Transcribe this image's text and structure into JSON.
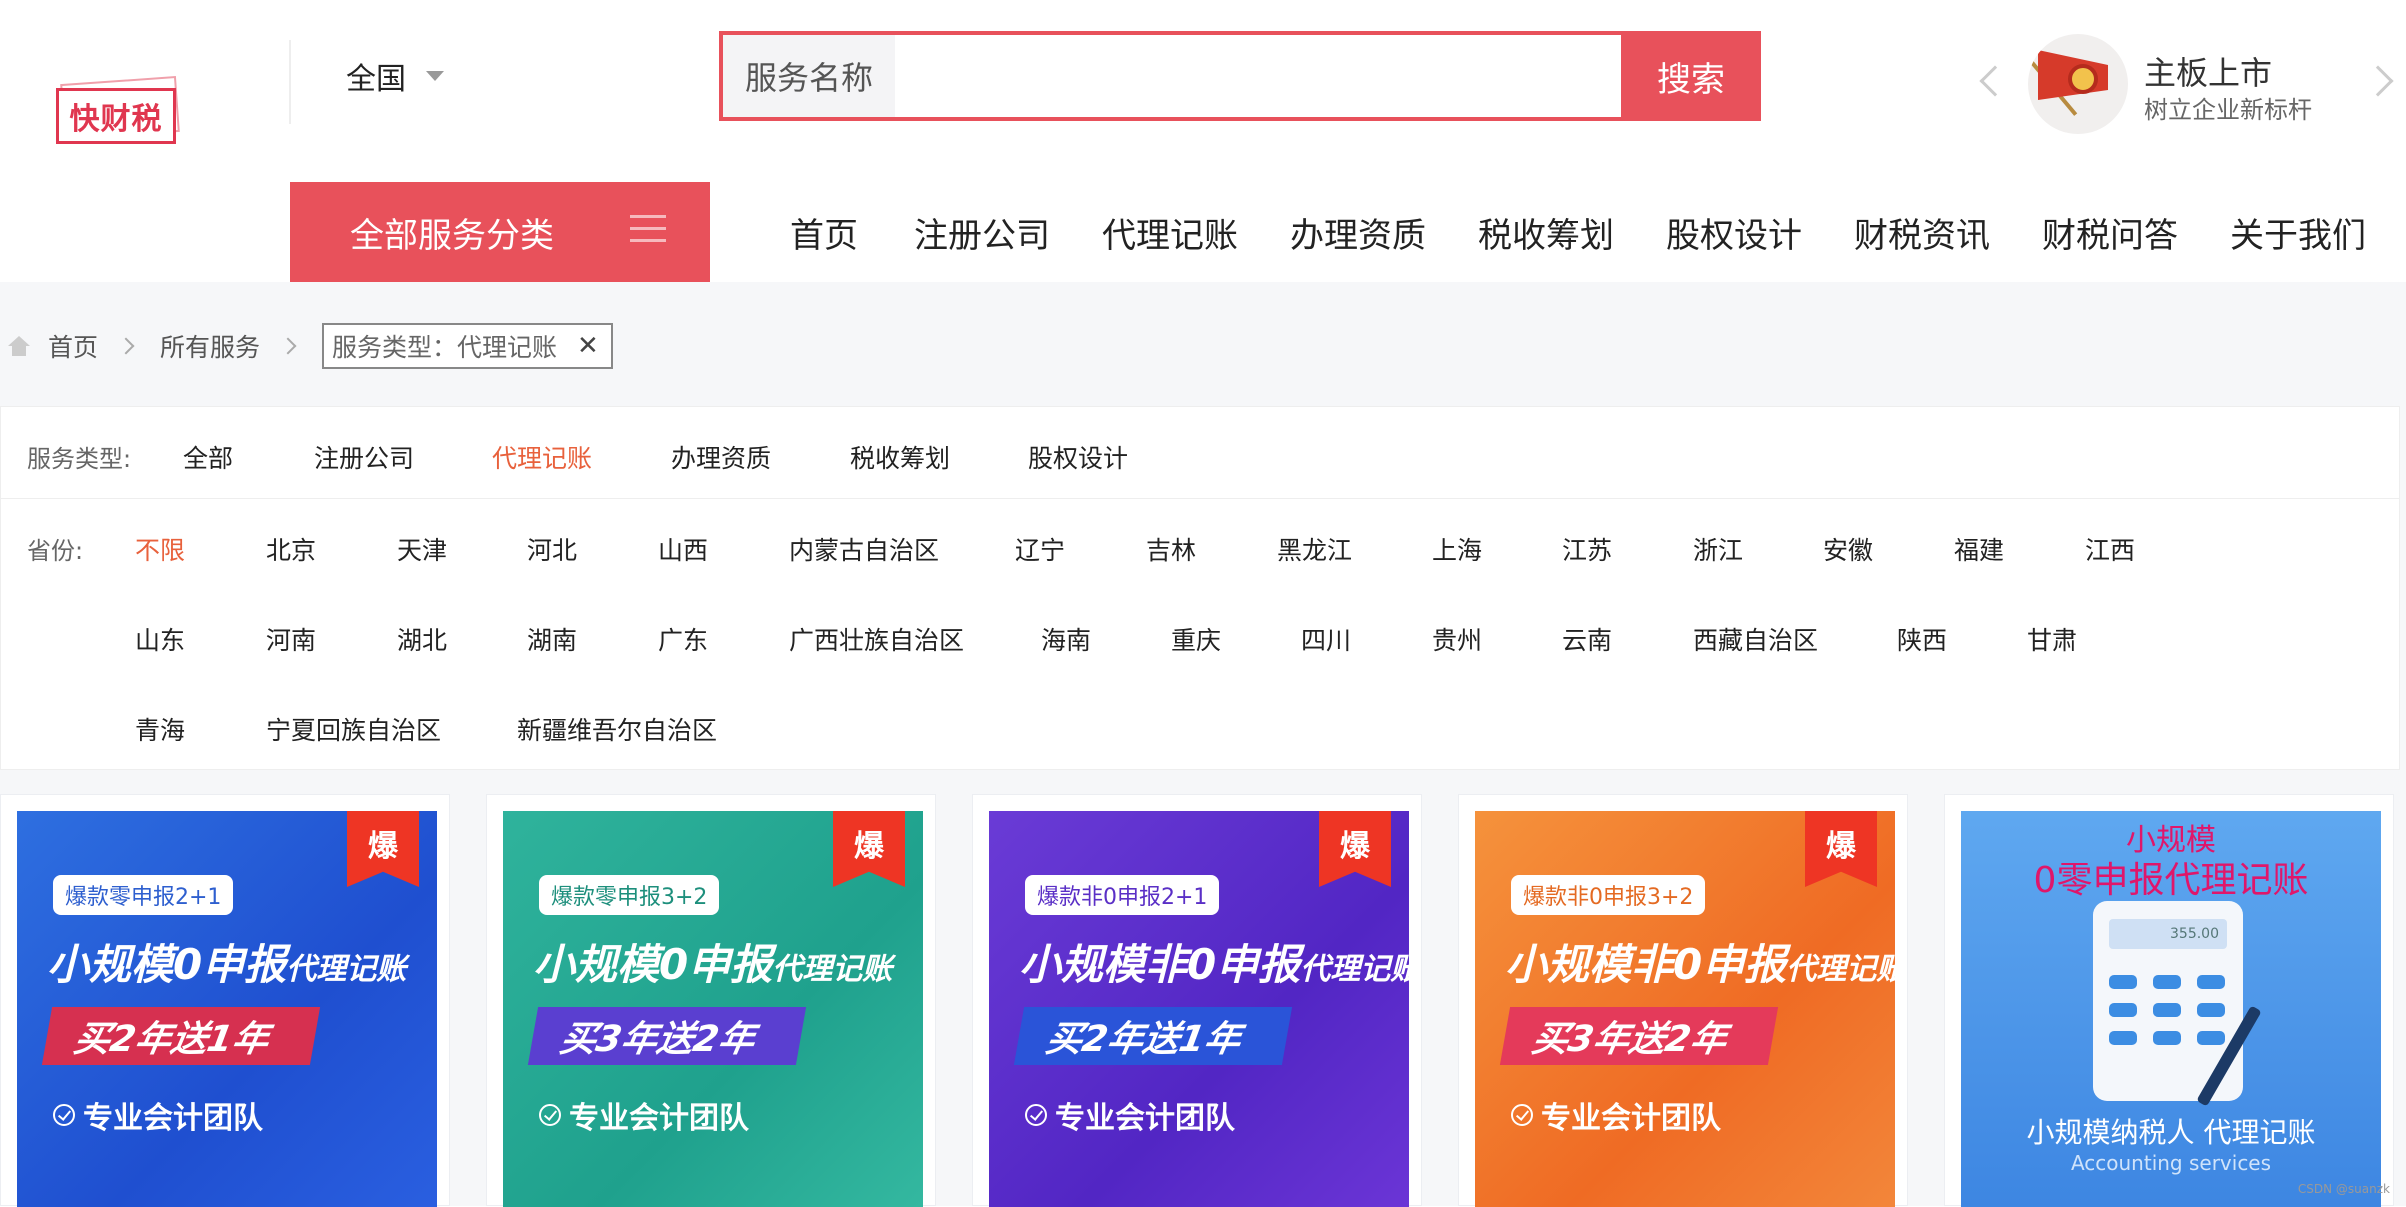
{
  "header": {
    "logo_text": "快财税",
    "city": "全国",
    "search": {
      "label": "服务名称",
      "value": "",
      "placeholder": "",
      "button": "搜索"
    },
    "promo": {
      "title": "主板上市",
      "subtitle": "树立企业新标杆"
    }
  },
  "nav": {
    "all_categories": "全部服务分类",
    "items": [
      "首页",
      "注册公司",
      "代理记账",
      "办理资质",
      "税收筹划",
      "股权设计",
      "财税资讯",
      "财税问答",
      "关于我们"
    ]
  },
  "breadcrumb": {
    "home": "首页",
    "all": "所有服务",
    "tag": "服务类型：代理记账",
    "tag_close": "✕"
  },
  "filters": {
    "service_label": "服务类型:",
    "service_options": [
      "全部",
      "注册公司",
      "代理记账",
      "办理资质",
      "税收筹划",
      "股权设计"
    ],
    "service_active": "代理记账",
    "province_label": "省份:",
    "province_options": [
      "不限",
      "北京",
      "天津",
      "河北",
      "山西",
      "内蒙古自治区",
      "辽宁",
      "吉林",
      "黑龙江",
      "上海",
      "江苏",
      "浙江",
      "安徽",
      "福建",
      "江西",
      "山东",
      "河南",
      "湖北",
      "湖南",
      "广东",
      "广西壮族自治区",
      "海南",
      "重庆",
      "四川",
      "贵州",
      "云南",
      "西藏自治区",
      "陕西",
      "甘肃",
      "青海",
      "宁夏回族自治区",
      "新疆维吾尔自治区"
    ],
    "province_active": "不限"
  },
  "cards": [
    {
      "badge": "爆",
      "pill": "爆款零申报2+1",
      "line_big": "小规模0申报",
      "line_small": "代理记账",
      "offer": "买2年送1年",
      "feature": "专业会计团队",
      "theme": "blue"
    },
    {
      "badge": "爆",
      "pill": "爆款零申报3+2",
      "line_big": "小规模0申报",
      "line_small": "代理记账",
      "offer": "买3年送2年",
      "feature": "专业会计团队",
      "theme": "teal"
    },
    {
      "badge": "爆",
      "pill": "爆款非0申报2+1",
      "line_big": "小规模非0申报",
      "line_small": "代理记账",
      "offer": "买2年送1年",
      "feature": "专业会计团队",
      "theme": "purple"
    },
    {
      "badge": "爆",
      "pill": "爆款非0申报3+2",
      "line_big": "小规模非0申报",
      "line_small": "代理记账",
      "offer": "买3年送2年",
      "feature": "专业会计团队",
      "theme": "orange"
    },
    {
      "title1": "小规模",
      "title2": "0零申报代理记账",
      "screen": "355.00",
      "footer": "小规模纳税人 代理记账",
      "footer_en": "Accounting services"
    }
  ],
  "watermark": "CSDN @suanzk",
  "colors": {
    "accent": "#e8515b",
    "active_filter": "#e8613c"
  }
}
